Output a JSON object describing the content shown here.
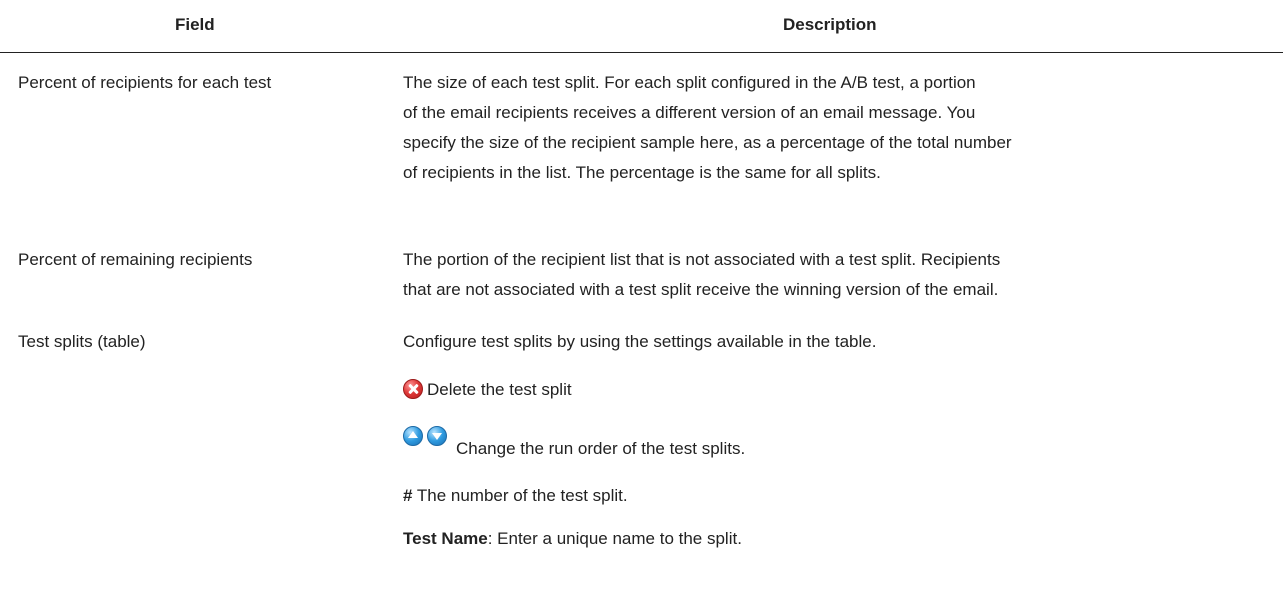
{
  "header": {
    "field": "Field",
    "description": "Description"
  },
  "rows": [
    {
      "field": "Percent of recipients for each test",
      "description_lines": [
        "The size of each test split. For each split configured in the A/B test, a portion",
        "of the email recipients receives a different version of an email message. You",
        "specify the size of the recipient sample here, as a percentage of the total number",
        "of recipients in the list. The percentage is the same for all splits."
      ]
    },
    {
      "field": "Percent of remaining recipients",
      "description_lines": [
        "The portion of the recipient list that is not associated with a test split. Recipients",
        "that are not associated with a test split receive the winning version of the email."
      ]
    },
    {
      "field": "Test splits (table)",
      "intro": "Configure test splits by using the settings available in the table.",
      "delete_text": "Delete the test split",
      "order_text": "Change the run order of the test splits.",
      "hash_symbol": "#",
      "hash_text": " The number of the test split.",
      "test_name_label": "Test Name",
      "test_name_text": ": Enter a unique name to the split."
    }
  ],
  "icons": {
    "delete": "delete-circle-icon",
    "move_up": "move-up-icon",
    "move_down": "move-down-icon"
  },
  "colors": {
    "delete_icon": "#e03b3b",
    "arrow_icon": "#2f9be0",
    "text": "#222222",
    "header_rule": "#222222"
  }
}
